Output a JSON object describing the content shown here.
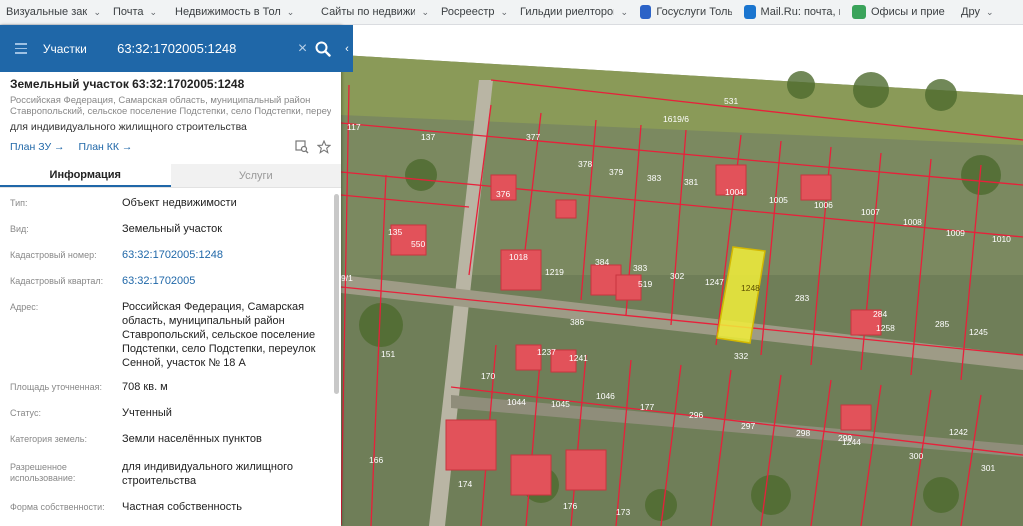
{
  "bookmarks": [
    {
      "label": "Визуальные заклад",
      "chevron": true,
      "favicon": false
    },
    {
      "label": "Почта",
      "chevron": true,
      "favicon": false
    },
    {
      "label": "Недвижимость в Тол",
      "chevron": true,
      "favicon": false
    },
    {
      "label": "Сайты по недвижим",
      "chevron": true,
      "favicon": false
    },
    {
      "label": "Росреестр",
      "chevron": true,
      "favicon": false
    },
    {
      "label": "Гильдии риелторов",
      "chevron": true,
      "favicon": false
    },
    {
      "label": "Госуслуги Тольятт",
      "chevron": false,
      "favicon": true,
      "favicon_color": "#2c63c7"
    },
    {
      "label": "Mail.Ru: почта, пои",
      "chevron": false,
      "favicon": true,
      "favicon_color": "#1a75cf"
    },
    {
      "label": "Офисы и прие",
      "chevron": false,
      "favicon": true,
      "favicon_color": "#3aa35a"
    },
    {
      "label": "Дру",
      "chevron": true,
      "favicon": false
    }
  ],
  "search": {
    "layer": "Участки",
    "query": "63:32:1702005:1248",
    "clear_icon": "close-icon",
    "search_icon": "search-icon"
  },
  "parcel": {
    "title": "Земельный участок 63:32:1702005:1248",
    "address_line1": "Российская Федерация, Самарская область, муниципальный район",
    "address_line2": "Ставропольский, сельское поселение Подстепки, село Подстепки, переулок",
    "use": "для индивидуального жилищного строительства",
    "plan_zu": "План ЗУ →",
    "plan_kk": "План КК →"
  },
  "tabs": {
    "info": "Информация",
    "services": "Услуги"
  },
  "properties": [
    {
      "key": "Тип:",
      "value": "Объект недвижимости",
      "link": false
    },
    {
      "key": "Вид:",
      "value": "Земельный участок",
      "link": false
    },
    {
      "key": "Кадастровый номер:",
      "value": "63:32:1702005:1248",
      "link": true
    },
    {
      "key": "Кадастровый квартал:",
      "value": "63:32:1702005",
      "link": true
    },
    {
      "key": "Адрес:",
      "value": "Российская Федерация, Самарская область, муниципальный район Ставропольский, сельское поселение Подстепки, село Подстепки, переулок Сенной, участок № 18 А",
      "link": false
    },
    {
      "key": "Площадь уточненная:",
      "value": "708 кв. м",
      "link": false
    },
    {
      "key": "Статус:",
      "value": "Учтенный",
      "link": false
    },
    {
      "key": "Категория земель:",
      "value": "Земли населённых пунктов",
      "link": false
    },
    {
      "key": "Разрешенное использование:",
      "value": "для индивидуального жилищного строительства",
      "link": false
    },
    {
      "key": "Форма собственности:",
      "value": "Частная собственность",
      "link": false
    }
  ],
  "map": {
    "parcel_labels": [
      "117",
      "137",
      "377",
      "378",
      "379",
      "383",
      "381",
      "531",
      "1619/6",
      "1004",
      "1005",
      "1006",
      "1007",
      "1008",
      "1009",
      "1010",
      "135",
      "550",
      "376",
      "1018",
      "1219",
      "384",
      "383",
      "519",
      "302",
      "1247",
      "1248",
      "283",
      "284",
      "1258",
      "285",
      "1245",
      "9/1",
      "386",
      "332",
      "151",
      "170",
      "1237",
      "1241",
      "1044",
      "1045",
      "1046",
      "177",
      "296",
      "297",
      "298",
      "299",
      "1244",
      "300",
      "166",
      "174",
      "176",
      "173",
      "301",
      "1242"
    ],
    "selected_parcel": "1248",
    "parcel_line_color": "#e8203a",
    "selected_fill_color": "#f2ee3a"
  }
}
